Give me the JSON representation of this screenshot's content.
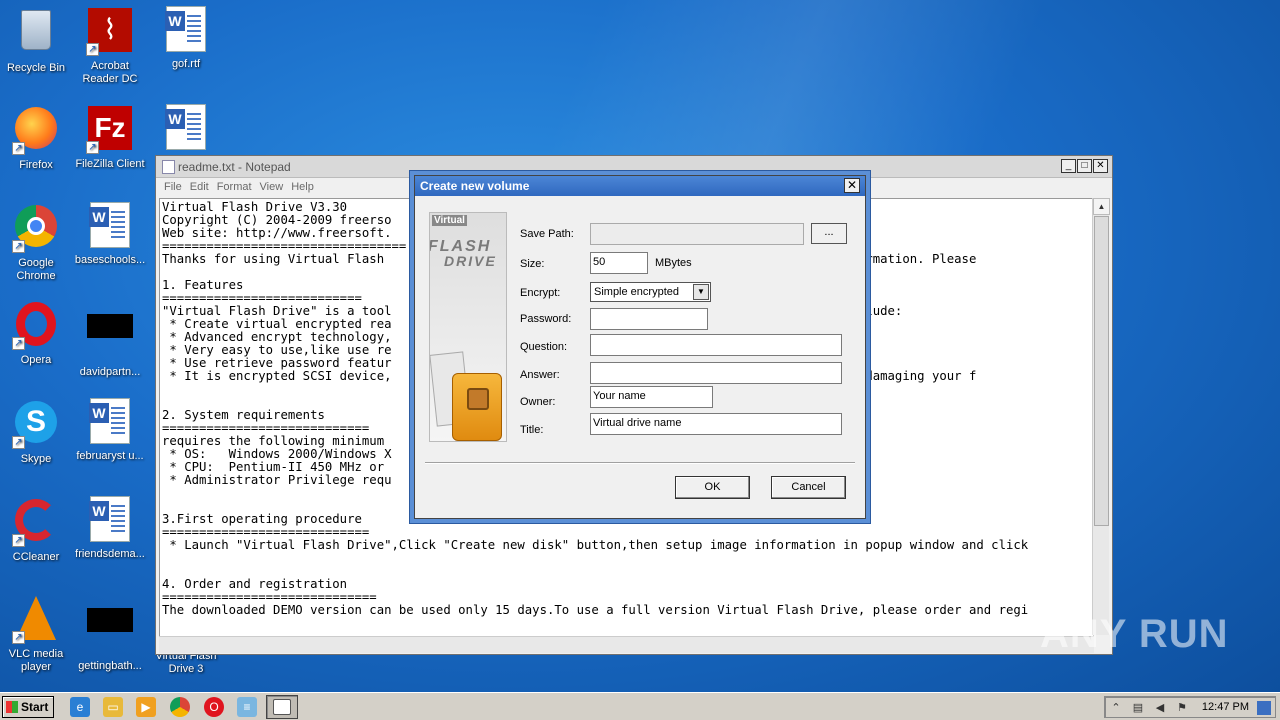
{
  "desktop": {
    "icons": [
      {
        "label": "Recycle Bin"
      },
      {
        "label": "Acrobat Reader DC"
      },
      {
        "label": "gof.rtf"
      },
      {
        "label": "Firefox"
      },
      {
        "label": "FileZilla Client"
      },
      {
        "label": "Google Chrome"
      },
      {
        "label": "baseschools..."
      },
      {
        "label": "Opera"
      },
      {
        "label": "davidpartn..."
      },
      {
        "label": "Skype"
      },
      {
        "label": "februaryst u..."
      },
      {
        "label": "CCleaner"
      },
      {
        "label": "friendsdema..."
      },
      {
        "label": "VLC media player"
      },
      {
        "label": "gettingbath..."
      },
      {
        "label": "Virtual Flash Drive 3"
      }
    ]
  },
  "notepad": {
    "title": "readme.txt - Notepad",
    "menu": [
      "File",
      "Edit",
      "Format",
      "View",
      "Help"
    ],
    "text": "Virtual Flash Drive V3.30\nCopyright (C) 2004-2009 freerso\nWeb site: http://www.freersoft.\n=================================\nThanks for using Virtual Flash                                                     chnical information. Please\n\n1. Features\n===========================\n\"Virtual Flash Drive\" is a tool                                                    features include:\n * Create virtual encrypted rea\n * Advanced encrypt technology,                                                    elete ect...\n * Very easy to use,like use re\n * Use retrieve password featur\n * It is encrypted SCSI device,                                                    worry about damaging your f\n\n\n2. System requirements\n============================\nrequires the following minimum\n * OS:   Windows 2000/Windows X\n * CPU:  Pentium-II 450 MHz or\n * Administrator Privilege requ\n\n\n3.First operating procedure\n============================\n * Launch \"Virtual Flash Drive\",Click \"Create new disk\" button,then setup image information in popup window and click\n\n\n4. Order and registration\n=============================\nThe downloaded DEMO version can be used only 15 days.To use a full version Virtual Flash Drive, please order and regi"
  },
  "dialog": {
    "title": "Create new volume",
    "banner_top": "Virtual",
    "banner_flash": "FLASH",
    "banner_drive": "DRIVE",
    "fields": {
      "save_path_label": "Save Path:",
      "save_path_value": "",
      "browse_label": "...",
      "size_label": "Size:",
      "size_value": "50",
      "size_unit": "MBytes",
      "encrypt_label": "Encrypt:",
      "encrypt_value": "Simple encrypted",
      "password_label": "Password:",
      "password_value": "",
      "question_label": "Question:",
      "question_value": "",
      "answer_label": "Answer:",
      "answer_value": "",
      "owner_label": "Owner:",
      "owner_value": "Your name",
      "title_label": "Title:",
      "title_value": "Virtual drive name"
    },
    "ok_label": "OK",
    "cancel_label": "Cancel"
  },
  "taskbar": {
    "start_label": "Start",
    "clock": "12:47 PM"
  },
  "watermark": "ANY RUN",
  "colors": {
    "desktop": "#1a6dc9",
    "dialog_title": "#2f68bf",
    "taskbar": "#d4d0c8"
  }
}
